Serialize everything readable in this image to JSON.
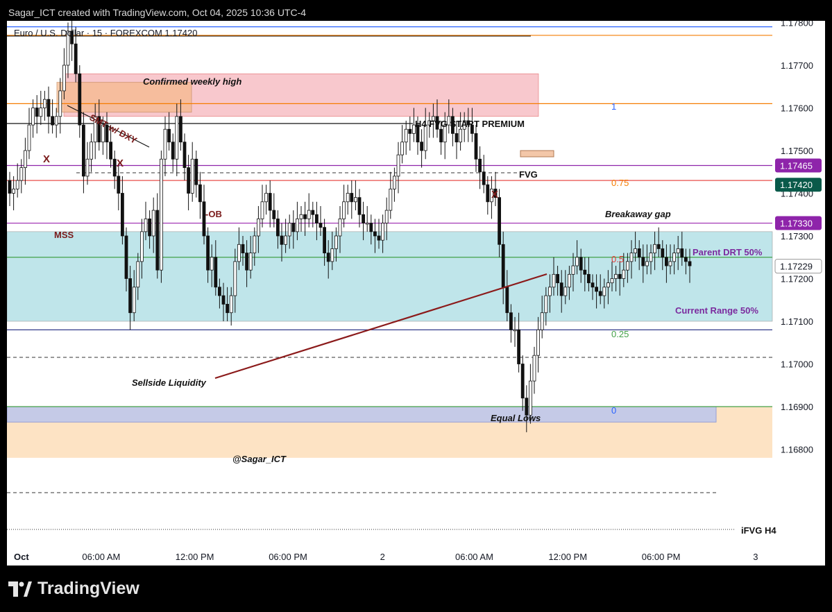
{
  "header": {
    "text": "Sagar_ICT created with TradingView.com, Oct 04, 2025 10:36 UTC-4"
  },
  "chart_title": "Euro / U.S. Dollar · 15 · FOREXCOM  1.17420",
  "brand": {
    "name": "TradingView"
  },
  "chart_data": {
    "type": "candlestick",
    "symbol": "Euro / U.S. Dollar",
    "interval": "15",
    "exchange": "FOREXCOM",
    "last_price": 1.1742,
    "ylim": [
      1.1676,
      1.1799
    ],
    "y_ticks": [
      "1.17900",
      "1.17800",
      "1.17700",
      "1.17600",
      "1.17500",
      "1.17400",
      "1.17300",
      "1.17200",
      "1.17100",
      "1.17000",
      "1.16900",
      "1.16800"
    ],
    "y_tick_values": [
      1.179,
      1.178,
      1.177,
      1.176,
      1.175,
      1.174,
      1.173,
      1.172,
      1.171,
      1.17,
      1.169,
      1.168
    ],
    "x_ticks": [
      "Oct",
      "06:00 AM",
      "12:00 PM",
      "06:00 PM",
      "2",
      "06:00 AM",
      "12:00 PM",
      "06:00 PM",
      "3"
    ],
    "x_tick_candle": [
      0,
      24,
      48,
      72,
      96,
      120,
      144,
      168,
      192
    ],
    "closes": [
      1.174,
      1.1741,
      1.1743,
      1.1746,
      1.175,
      1.1756,
      1.176,
      1.1758,
      1.176,
      1.1762,
      1.1758,
      1.1756,
      1.1758,
      1.1764,
      1.177,
      1.1778,
      1.1775,
      1.1768,
      1.1756,
      1.1744,
      1.1748,
      1.1752,
      1.1758,
      1.1752,
      1.1756,
      1.1752,
      1.1748,
      1.1744,
      1.174,
      1.173,
      1.172,
      1.1712,
      1.1718,
      1.1724,
      1.1731,
      1.1734,
      1.173,
      1.1736,
      1.1722,
      1.1748,
      1.1755,
      1.1752,
      1.1748,
      1.1758,
      1.1752,
      1.1746,
      1.174,
      1.1748,
      1.1742,
      1.1738,
      1.173,
      1.1722,
      1.1725,
      1.1718,
      1.1716,
      1.1714,
      1.1712,
      1.1716,
      1.1724,
      1.1728,
      1.1726,
      1.1722,
      1.1726,
      1.173,
      1.1734,
      1.1738,
      1.174,
      1.1736,
      1.1734,
      1.173,
      1.1728,
      1.173,
      1.1733,
      1.1731,
      1.1734,
      1.1735,
      1.1734,
      1.1736,
      1.1735,
      1.1733,
      1.1732,
      1.1726,
      1.1724,
      1.1727,
      1.173,
      1.1734,
      1.1738,
      1.174,
      1.1738,
      1.1739,
      1.1735,
      1.1733,
      1.1733,
      1.1731,
      1.173,
      1.1729,
      1.1733,
      1.1736,
      1.1741,
      1.1744,
      1.1749,
      1.1752,
      1.1755,
      1.1754,
      1.1756,
      1.1752,
      1.175,
      1.1756,
      1.1757,
      1.1758,
      1.1755,
      1.1752,
      1.1756,
      1.1758,
      1.1754,
      1.1752,
      1.1755,
      1.1757,
      1.1756,
      1.1754,
      1.1748,
      1.1745,
      1.1742,
      1.1738,
      1.1741,
      1.1739,
      1.1728,
      1.1718,
      1.1712,
      1.1708,
      1.1708,
      1.17,
      1.1692,
      1.1688,
      1.1696,
      1.1702,
      1.1708,
      1.1712,
      1.1716,
      1.1718,
      1.1721,
      1.1719,
      1.1716,
      1.1718,
      1.1721,
      1.1723,
      1.1725,
      1.1722,
      1.1721,
      1.1719,
      1.1718,
      1.1717,
      1.1716,
      1.1718,
      1.1719,
      1.172,
      1.1721,
      1.172,
      1.1722,
      1.1724,
      1.1726,
      1.1727,
      1.1725,
      1.1723,
      1.1724,
      1.1726,
      1.1728,
      1.1727,
      1.1725,
      1.1723,
      1.1724,
      1.1726,
      1.1727,
      1.1725,
      1.1724,
      1.1723
    ],
    "horizontal_levels": [
      {
        "price": 1.1779,
        "color": "#2962ff"
      },
      {
        "price": 1.1777,
        "color": "#f57c00"
      },
      {
        "price": 1.1761,
        "color": "#f57c00"
      },
      {
        "price": 1.17465,
        "color": "#8e24aa"
      },
      {
        "price": 1.1743,
        "color": "#e53935"
      },
      {
        "price": 1.1733,
        "color": "#9c27b0"
      },
      {
        "price": 1.1725,
        "color": "#43a047"
      },
      {
        "price": 1.1708,
        "color": "#1a237e"
      },
      {
        "price": 1.169,
        "color": "#43a047"
      }
    ],
    "zones": [
      {
        "label": "Current range",
        "from": 1.171,
        "to": 1.1731,
        "color": "#bfe5ea"
      },
      {
        "label": "premium",
        "from": 1.1758,
        "to": 1.1768,
        "color": "#f8c8cd"
      },
      {
        "label": "iFVG",
        "from": 1.1678,
        "to": 1.169,
        "color": "#fde3c4"
      }
    ],
    "fib_labels": [
      "1",
      "0.75",
      "0.5",
      "0.25",
      "0"
    ],
    "price_badges": [
      {
        "text": "1.17465",
        "color": "#8e24aa"
      },
      {
        "text": "1.17420",
        "color": "#0a5a4a"
      },
      {
        "text": "1.17330",
        "color": "#8e24aa"
      },
      {
        "text": "1.17229",
        "color": "#ffffff"
      }
    ],
    "annotations": [
      "Confirmed weekly high",
      "SMT w/ DXY",
      "H4 FVG START PREMIUM",
      "FVG",
      "X",
      "X",
      "X",
      "-OB",
      "MSS",
      "Breakaway gap",
      "Parent DRT 50%",
      "Current Range 50%",
      "Sellside Liquidity",
      "Equal Lows",
      "@Sagar_ICT",
      "iFVG H4"
    ]
  }
}
